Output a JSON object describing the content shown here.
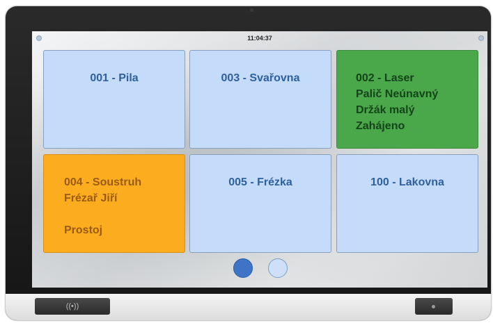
{
  "status_bar": {
    "time": "11:04:37"
  },
  "tiles": [
    {
      "text": "001 - Pila",
      "color": "#c4dcf9"
    },
    {
      "text": "003 - Svařovna",
      "color": "#c4dcf9"
    },
    {
      "text": "002 - Laser\nPalič Neúnavný\nDržák malý\nZahájeno",
      "color": "#4aa84b"
    },
    {
      "text": "004 - Soustruh\nFrézař Jiří\n\nProstoj",
      "color": "#fbac1f"
    },
    {
      "text": "005 - Frézka",
      "color": "#c4dcf9"
    },
    {
      "text": "100 - Lakovna",
      "color": "#c4dcf9"
    }
  ],
  "pagination": {
    "current_page": 1,
    "page_count": 2,
    "active_color": "#3e73c6",
    "inactive_color": "#cde0f7"
  },
  "device": {
    "nfc_icon": "((•))"
  }
}
